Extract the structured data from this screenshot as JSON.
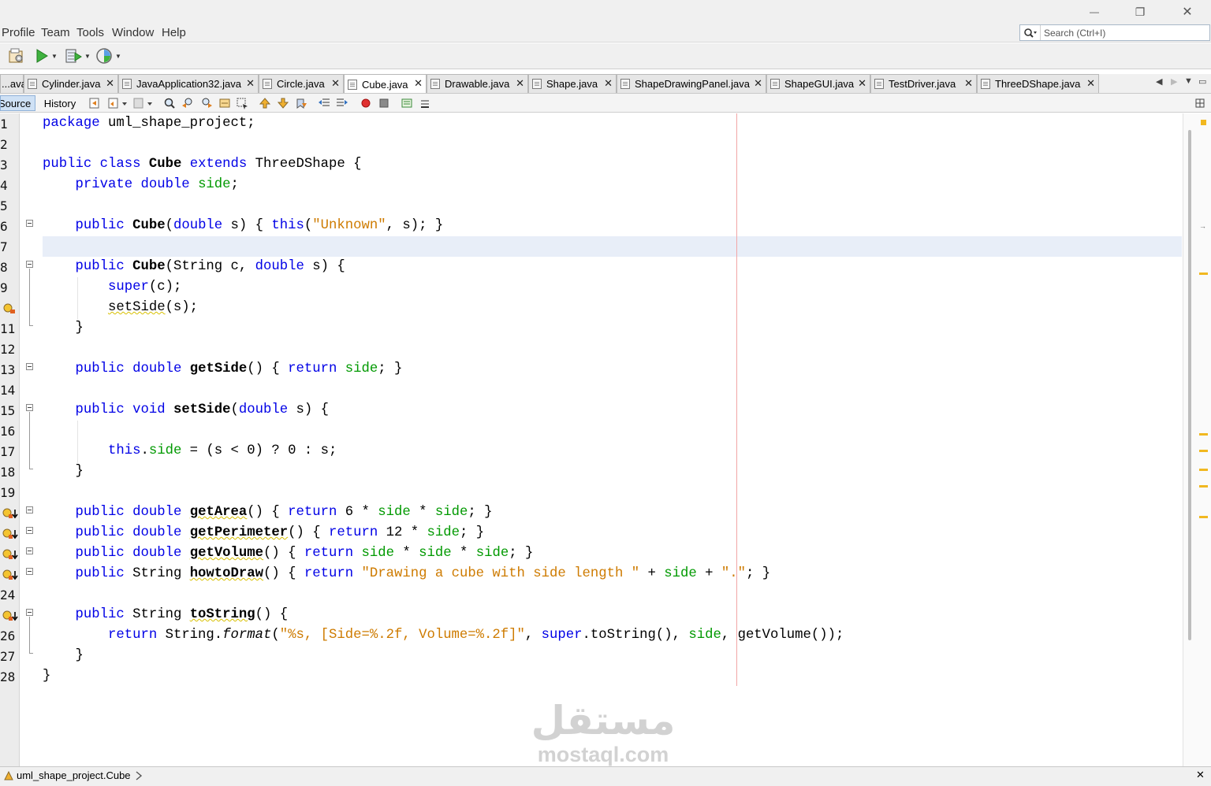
{
  "window": {
    "minimize_glyph": "—",
    "restore_glyph": "❐",
    "close_glyph": "✕"
  },
  "menu": {
    "items": [
      "Profile",
      "Team",
      "Tools",
      "Window",
      "Help"
    ],
    "search_placeholder": "Search (Ctrl+I)"
  },
  "toolbar": {
    "icons": [
      "project-properties-icon",
      "run-icon",
      "debug-icon",
      "profile-icon"
    ]
  },
  "tabs": {
    "items": [
      {
        "label": "...ava"
      },
      {
        "label": "Cylinder.java"
      },
      {
        "label": "JavaApplication32.java"
      },
      {
        "label": "Circle.java"
      },
      {
        "label": "Cube.java",
        "active": true
      },
      {
        "label": "Drawable.java"
      },
      {
        "label": "Shape.java"
      },
      {
        "label": "ShapeDrawingPanel.java"
      },
      {
        "label": "ShapeGUI.java"
      },
      {
        "label": "TestDriver.java"
      },
      {
        "label": "ThreeDShape.java"
      }
    ],
    "close_glyph": "✕"
  },
  "editor_toolbar": {
    "source_label": "Source",
    "history_label": "History"
  },
  "editor": {
    "line_numbers": [
      "1",
      "2",
      "3",
      "4",
      "5",
      "6",
      "7",
      "8",
      "9",
      "",
      "11",
      "12",
      "13",
      "14",
      "15",
      "16",
      "17",
      "18",
      "19",
      "",
      "",
      "",
      "",
      "24",
      "",
      "26",
      "27",
      "28"
    ],
    "lines": [
      "package uml_shape_project;",
      "",
      "public class Cube extends ThreeDShape {",
      "    private double side;",
      "",
      "    public Cube(double s) { this(\"Unknown\", s); }",
      "",
      "    public Cube(String c, double s) {",
      "        super(c);",
      "        setSide(s);",
      "    }",
      "",
      "    public double getSide() { return side; }",
      "",
      "    public void setSide(double s) {",
      "",
      "        this.side = (s < 0) ? 0 : s;",
      "    }",
      "",
      "    public double getArea() { return 6 * side * side; }",
      "    public double getPerimeter() { return 12 * side; }",
      "    public double getVolume() { return side * side * side; }",
      "    public String howtoDraw() { return \"Drawing a cube with side length \" + side + \".\"; }",
      "",
      "    public String toString() {",
      "        return String.format(\"%s, [Side=%.2f, Volume=%.2f]\", super.toString(), side, getVolume());",
      "    }",
      "}"
    ]
  },
  "watermark": {
    "arabic": "مستقل",
    "latin": "mostaql.com"
  },
  "status": {
    "breadcrumb": "uml_shape_project.Cube",
    "close_glyph": "✕"
  },
  "colors": {
    "keyword": "#0000e6",
    "field": "#009900",
    "string": "#ce7b00",
    "current_line": "#e8eef8",
    "margin_line": "#f2a6a6"
  }
}
